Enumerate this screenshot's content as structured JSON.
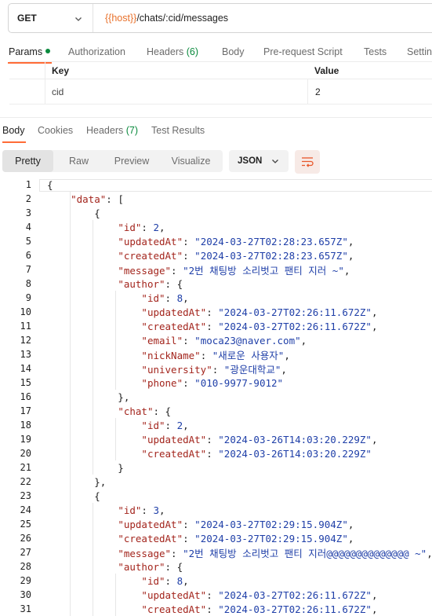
{
  "request": {
    "method": "GET",
    "url_var": "{{host}}",
    "url_path": "/chats/:cid/messages"
  },
  "request_tabs": [
    {
      "label": "Params",
      "count": "",
      "active": true
    },
    {
      "label": "Authorization",
      "count": "",
      "active": false
    },
    {
      "label": "Headers",
      "count": "(6)",
      "active": false
    },
    {
      "label": "Body",
      "count": "",
      "active": false
    },
    {
      "label": "Pre-request Script",
      "count": "",
      "active": false
    },
    {
      "label": "Tests",
      "count": "",
      "active": false
    },
    {
      "label": "Settin",
      "count": "",
      "active": false
    }
  ],
  "params": {
    "headers": {
      "key": "Key",
      "value": "Value"
    },
    "rows": [
      {
        "key": "cid",
        "value": "2"
      }
    ]
  },
  "response_tabs": [
    {
      "label": "Body",
      "count": "",
      "active": true
    },
    {
      "label": "Cookies",
      "count": "",
      "active": false
    },
    {
      "label": "Headers",
      "count": "(7)",
      "active": false
    },
    {
      "label": "Test Results",
      "count": "",
      "active": false
    }
  ],
  "view_modes": [
    "Pretty",
    "Raw",
    "Preview",
    "Visualize"
  ],
  "active_view_mode": "Pretty",
  "format": "JSON",
  "code_lines": [
    {
      "n": "1",
      "t": "{"
    },
    {
      "n": "2",
      "t": "    \"data\": ["
    },
    {
      "n": "3",
      "t": "        {"
    },
    {
      "n": "4",
      "t": "            \"id\": 2,"
    },
    {
      "n": "5",
      "t": "            \"updatedAt\": \"2024-03-27T02:28:23.657Z\","
    },
    {
      "n": "6",
      "t": "            \"createdAt\": \"2024-03-27T02:28:23.657Z\","
    },
    {
      "n": "7",
      "t": "            \"message\": \"2번 채팅방 소리벗고 팬티 지러 ~\","
    },
    {
      "n": "8",
      "t": "            \"author\": {"
    },
    {
      "n": "9",
      "t": "                \"id\": 8,"
    },
    {
      "n": "10",
      "t": "                \"updatedAt\": \"2024-03-27T02:26:11.672Z\","
    },
    {
      "n": "11",
      "t": "                \"createdAt\": \"2024-03-27T02:26:11.672Z\","
    },
    {
      "n": "12",
      "t": "                \"email\": \"moca23@naver.com\","
    },
    {
      "n": "13",
      "t": "                \"nickName\": \"새로운 사용자\","
    },
    {
      "n": "14",
      "t": "                \"university\": \"광운대학교\","
    },
    {
      "n": "15",
      "t": "                \"phone\": \"010-9977-9012\""
    },
    {
      "n": "16",
      "t": "            },"
    },
    {
      "n": "17",
      "t": "            \"chat\": {"
    },
    {
      "n": "18",
      "t": "                \"id\": 2,"
    },
    {
      "n": "19",
      "t": "                \"updatedAt\": \"2024-03-26T14:03:20.229Z\","
    },
    {
      "n": "20",
      "t": "                \"createdAt\": \"2024-03-26T14:03:20.229Z\""
    },
    {
      "n": "21",
      "t": "            }"
    },
    {
      "n": "22",
      "t": "        },"
    },
    {
      "n": "23",
      "t": "        {"
    },
    {
      "n": "24",
      "t": "            \"id\": 3,"
    },
    {
      "n": "25",
      "t": "            \"updatedAt\": \"2024-03-27T02:29:15.904Z\","
    },
    {
      "n": "26",
      "t": "            \"createdAt\": \"2024-03-27T02:29:15.904Z\","
    },
    {
      "n": "27",
      "t": "            \"message\": \"2번 채팅방 소리벗고 팬티 지러@@@@@@@@@@@@@@ ~\","
    },
    {
      "n": "28",
      "t": "            \"author\": {"
    },
    {
      "n": "29",
      "t": "                \"id\": 8,"
    },
    {
      "n": "30",
      "t": "                \"updatedAt\": \"2024-03-27T02:26:11.672Z\","
    },
    {
      "n": "31",
      "t": "                \"createdAt\": \"2024-03-27T02:26:11.672Z\","
    }
  ],
  "colors": {
    "accent": "#ff6c37",
    "count_green": "#0b8a3e",
    "json_key": "#a3251d",
    "json_value": "#1f3fa8",
    "url_variable": "#e8702a"
  }
}
